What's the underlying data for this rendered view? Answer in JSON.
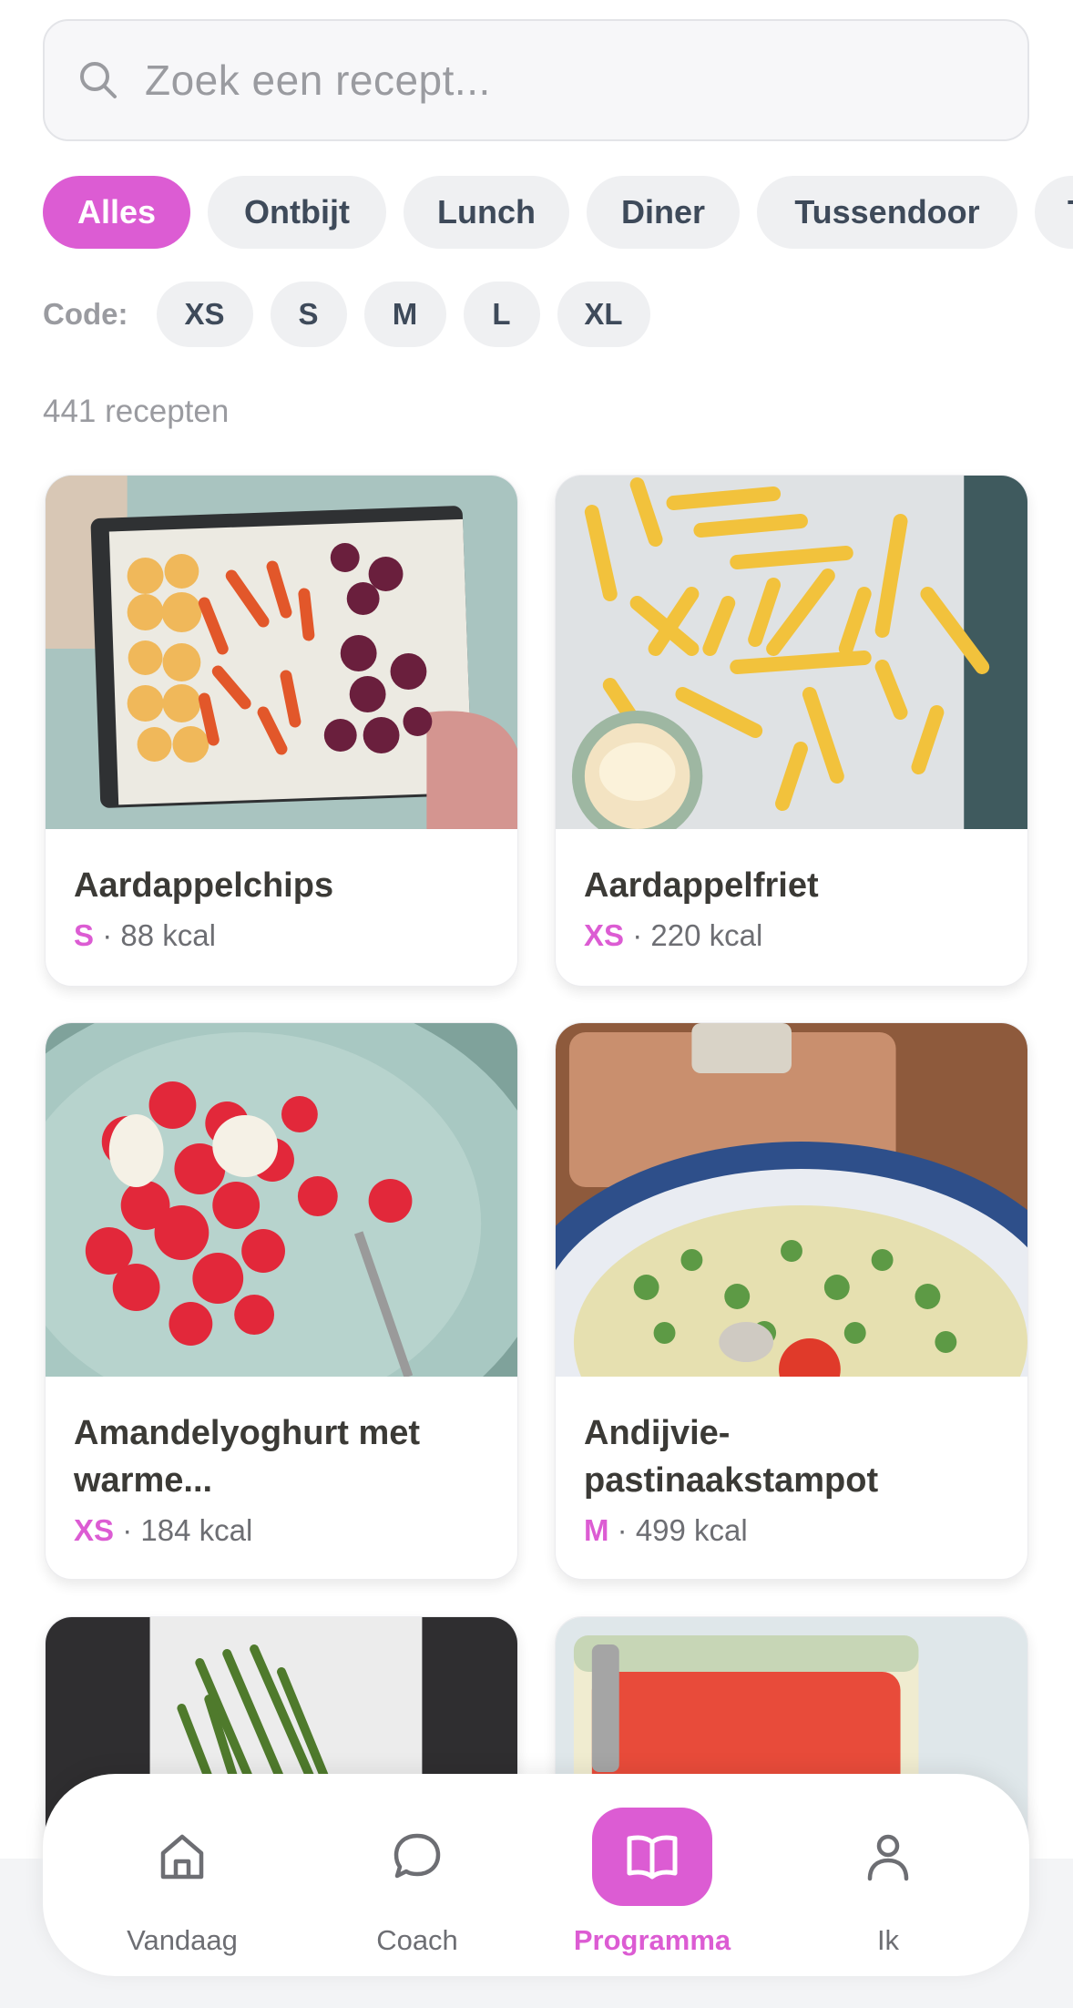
{
  "search": {
    "placeholder": "Zoek een recept..."
  },
  "categories": [
    {
      "label": "Alles",
      "active": true
    },
    {
      "label": "Ontbijt",
      "active": false
    },
    {
      "label": "Lunch",
      "active": false
    },
    {
      "label": "Diner",
      "active": false
    },
    {
      "label": "Tussendoor",
      "active": false
    },
    {
      "label": "T",
      "active": false
    }
  ],
  "code_filter": {
    "label": "Code:",
    "options": [
      "XS",
      "S",
      "M",
      "L",
      "XL"
    ]
  },
  "result_count": "441 recepten",
  "recipes": [
    {
      "title": "Aardappelchips",
      "code": "S",
      "kcal": "· 88 kcal"
    },
    {
      "title": "Aardappelfriet",
      "code": "XS",
      "kcal": "· 220 kcal"
    },
    {
      "title": "Amandelyoghurt met warme...",
      "code": "XS",
      "kcal": "· 184 kcal"
    },
    {
      "title": "Andijvie-pastinaakstampot",
      "code": "M",
      "kcal": "· 499 kcal"
    }
  ],
  "bottom_nav": [
    {
      "label": "Vandaag",
      "icon": "home-icon",
      "active": false
    },
    {
      "label": "Coach",
      "icon": "chat-bubble-icon",
      "active": false
    },
    {
      "label": "Programma",
      "icon": "open-book-icon",
      "active": true
    },
    {
      "label": "Ik",
      "icon": "person-icon",
      "active": false
    }
  ],
  "colors": {
    "accent": "#dc5cd3",
    "chip_bg": "#eff0f2",
    "muted_text": "#9a9ba0"
  }
}
